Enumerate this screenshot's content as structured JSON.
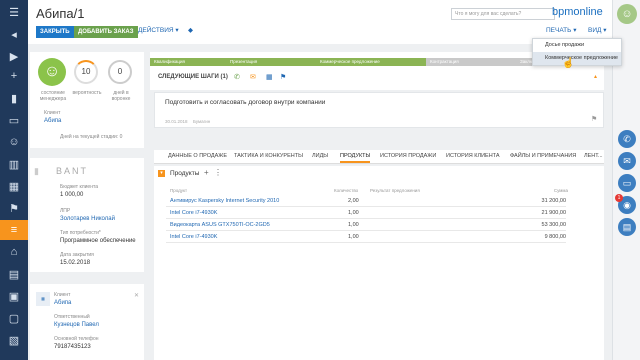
{
  "header": {
    "title": "Абипа/1",
    "buttons": {
      "close": "ЗАКРЫТЬ",
      "add_order": "ДОБАВИТЬ ЗАКАЗ",
      "actions": "ДЕЙСТВИЯ"
    },
    "search_placeholder": "Что я могу для вас сделать?",
    "logo": "bpmonline",
    "print": "ПЕЧАТЬ",
    "view": "ВИД"
  },
  "print_menu": {
    "items": [
      "Досье продажи",
      "Коммерческое предложение"
    ]
  },
  "kpi": {
    "v1": "10",
    "l1": "состояние менеджера",
    "l2": "вероятность",
    "v3": "0",
    "l3": "дней в воронке",
    "client_label": "Клиент",
    "client": "Абипа",
    "days_text": "Дней на текущей стадии: 0"
  },
  "stages": [
    "Квалификация",
    "Презентация",
    "Коммерческое предложение",
    "Контрактация",
    "Заключение"
  ],
  "next_steps": {
    "title": "СЛЕДУЮЩИЕ ШАГИ (1)",
    "task": "Подготовить и согласовать договор внутри компании",
    "date": "30.01.2018",
    "owner": "Бумагин"
  },
  "bant": {
    "title": "BANT",
    "budget_label": "Бюджет клиента",
    "budget": "1 000,00",
    "lpr_label": "ЛПР",
    "lpr": "Золотарев Николай",
    "need_label": "Тип потребности*",
    "need": "Программное обеспечение",
    "close_label": "Дата закрытия",
    "close": "15.02.2018"
  },
  "contact": {
    "client_label": "Клиент",
    "client": "Абипа",
    "resp_label": "Ответственный",
    "resp": "Кузнецов Павел",
    "phone_label": "Основной телефон",
    "phone": "79187435123"
  },
  "tabs": [
    "ДАННЫЕ О ПРОДАЖЕ",
    "ТАКТИКА И КОНКУРЕНТЫ",
    "ЛИДЫ",
    "ПРОДУКТЫ",
    "ИСТОРИЯ ПРОДАЖИ",
    "ИСТОРИЯ КЛИЕНТА",
    "ФАЙЛЫ И ПРИМЕЧАНИЯ",
    "ЛЕНТ..."
  ],
  "products": {
    "title": "Продукты",
    "cols": [
      "Продукт",
      "Количество",
      "Результат предложения",
      "Сумма"
    ],
    "rows": [
      [
        "Антивирус Kaspersky Internet Security 2010",
        "2,00",
        "",
        "31 200,00"
      ],
      [
        "Intel Core i7-4930K",
        "1,00",
        "",
        "21 900,00"
      ],
      [
        "Видеокарта ASUS GTX750TI-OC-2GD5",
        "1,00",
        "",
        "53 300,00"
      ],
      [
        "Intel Core i7-4930K",
        "1,00",
        "",
        "9 800,00"
      ]
    ]
  },
  "badge": "1"
}
